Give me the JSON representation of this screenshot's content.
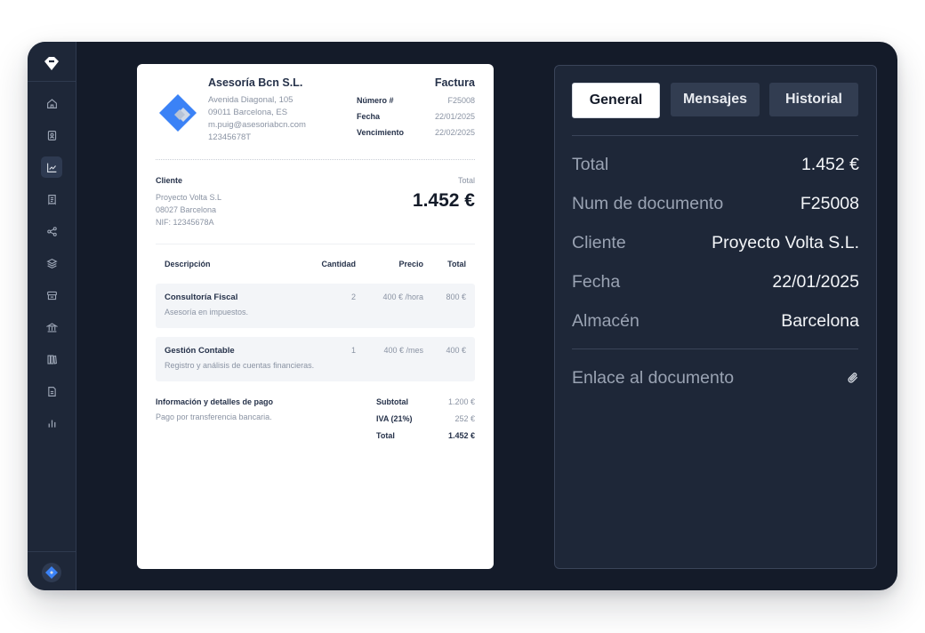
{
  "invoice": {
    "company": {
      "name": "Asesoría Bcn S.L.",
      "address_lines": [
        "Avenida Diagonal, 105",
        "09011 Barcelona, ES",
        "m.puig@asesoriabcn.com",
        "12345678T"
      ]
    },
    "doc_title": "Factura",
    "meta": [
      {
        "label": "Número #",
        "value": "F25008"
      },
      {
        "label": "Fecha",
        "value": "22/01/2025"
      },
      {
        "label": "Vencimiento",
        "value": "22/02/2025"
      }
    ],
    "client": {
      "heading": "Cliente",
      "lines": [
        "Proyecto Volta S.L",
        "08027 Barcelona",
        "NIF: 12345678A"
      ]
    },
    "total_label": "Total",
    "total_amount": "1.452 €",
    "table": {
      "headers": [
        "Descripción",
        "Cantidad",
        "Precio",
        "Total"
      ],
      "rows": [
        {
          "name": "Consultoría Fiscal",
          "desc": "Asesoría en impuestos.",
          "qty": "2",
          "price": "400 € /hora",
          "total": "800 €"
        },
        {
          "name": "Gestión Contable",
          "desc": "Registro y análisis de cuentas financieras.",
          "qty": "1",
          "price": "400 € /mes",
          "total": "400 €"
        }
      ]
    },
    "payment": {
      "heading": "Información y detalles de pago",
      "text": "Pago por transferencia bancaria."
    },
    "summary": [
      {
        "label": "Subtotal",
        "value": "1.200 €"
      },
      {
        "label": "IVA (21%)",
        "value": "252 €"
      },
      {
        "label": "Total",
        "value": "1.452 €"
      }
    ]
  },
  "panel": {
    "tabs": [
      "General",
      "Mensajes",
      "Historial"
    ],
    "active_tab": "General",
    "fields": [
      {
        "label": "Total",
        "value": "1.452 €"
      },
      {
        "label": "Num de documento",
        "value": "F25008"
      },
      {
        "label": "Cliente",
        "value": "Proyecto Volta S.L."
      },
      {
        "label": "Fecha",
        "value": "22/01/2025"
      },
      {
        "label": "Almacén",
        "value": "Barcelona"
      }
    ],
    "link_label": "Enlace al documento",
    "link_icon": "paperclip-icon"
  },
  "sidebar": {
    "active_index": 2,
    "icons": [
      "home-icon",
      "contacts-icon",
      "chart-line-icon",
      "receipt-icon",
      "share-icon",
      "layers-icon",
      "cash-register-icon",
      "bank-icon",
      "books-icon",
      "document-icon",
      "bar-chart-icon"
    ]
  },
  "colors": {
    "app_bg": "#141b29",
    "sidebar_bg": "#1e2738",
    "panel_bg": "#1e2738",
    "brand_blue": "#3b82f6",
    "text_light": "#f3f5f8",
    "text_muted": "#9aa3b3"
  }
}
